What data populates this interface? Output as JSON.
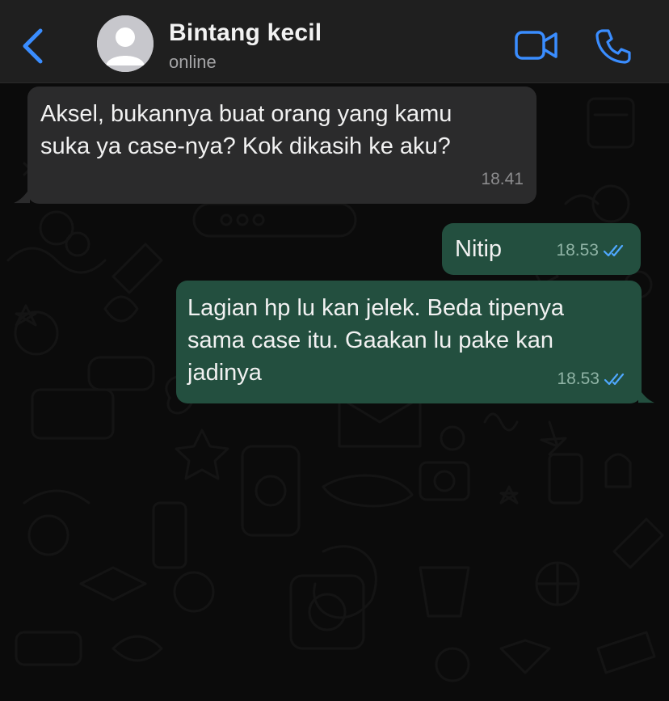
{
  "header": {
    "contact_name": "Bintang kecil",
    "status": "online",
    "icons": {
      "back": "chevron-left-icon",
      "avatar": "default-avatar-icon",
      "video": "video-camera-icon",
      "call": "phone-icon"
    },
    "accent_color": "#3a8dff"
  },
  "messages": [
    {
      "direction": "incoming",
      "text": "Aksel, bukannya buat orang yang kamu\nsuka ya case-nya? Kok dikasih ke aku?",
      "time": "18.41"
    },
    {
      "direction": "outgoing",
      "text": "Nitip",
      "time": "18.53",
      "status_icon": "double-check-read-icon"
    },
    {
      "direction": "outgoing",
      "text": "Lagian hp lu kan jelek. Beda tipenya\nsama case itu. Gaakan lu pake kan\njadinya",
      "time": "18.53",
      "status_icon": "double-check-read-icon"
    }
  ],
  "colors": {
    "incoming_bubble": "#2b2b2c",
    "outgoing_bubble": "#234f3f",
    "read_ticks": "#4fa8ff",
    "background": "#0b0b0b"
  }
}
